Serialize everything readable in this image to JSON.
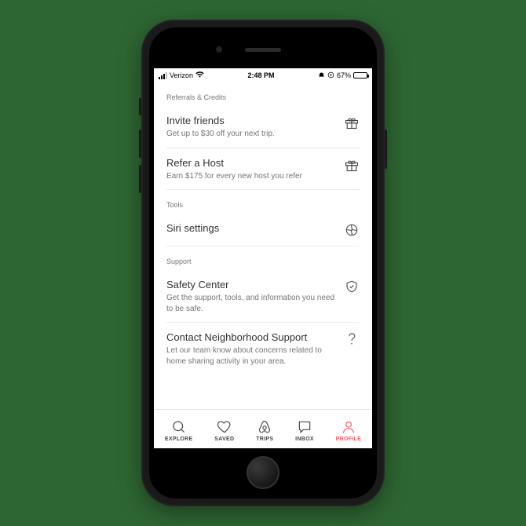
{
  "status_bar": {
    "carrier": "Verizon",
    "time": "2:48 PM",
    "battery_pct": "67%"
  },
  "sections": {
    "referrals": {
      "header": "Referrals & Credits",
      "invite": {
        "title": "Invite friends",
        "sub": "Get up to $30 off your next trip."
      },
      "refer_host": {
        "title": "Refer a Host",
        "sub": "Earn $175 for every new host you refer"
      }
    },
    "tools": {
      "header": "Tools",
      "siri": {
        "title": "Siri settings"
      }
    },
    "support": {
      "header": "Support",
      "safety": {
        "title": "Safety Center",
        "sub": "Get the support, tools, and information you need to be safe."
      },
      "neighborhood": {
        "title": "Contact Neighborhood Support",
        "sub": "Let our team know about concerns related to home sharing activity in your area."
      }
    }
  },
  "tabs": {
    "explore": "EXPLORE",
    "saved": "SAVED",
    "trips": "TRIPS",
    "inbox": "INBOX",
    "profile": "PROFILE"
  },
  "colors": {
    "accent": "#ff5a5f",
    "muted": "#767676"
  }
}
